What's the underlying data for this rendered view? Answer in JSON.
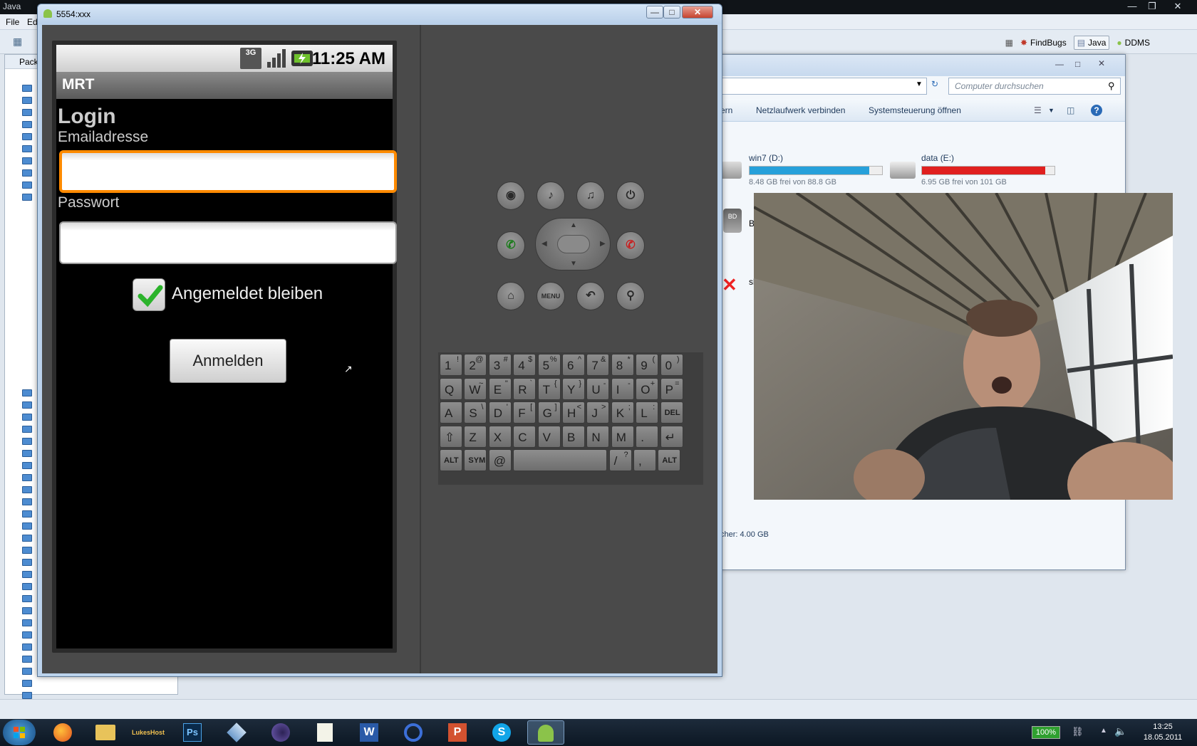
{
  "eclipse": {
    "title": "Java",
    "menu": [
      "File",
      "Ed"
    ],
    "perspectives": [
      "FindBugs",
      "Java",
      "DDMS"
    ],
    "package_explorer_title": "Pack"
  },
  "explorer": {
    "search_placeholder": "Computer durchsuchen",
    "commands": [
      "ern",
      "Netzlaufwerk verbinden",
      "Systemsteuerung öffnen"
    ],
    "drives": [
      {
        "name": "win7 (D:)",
        "free": "8.48 GB frei von 88.8 GB",
        "used_fraction": 0.905,
        "color": "#26a0da"
      },
      {
        "name": "data (E:)",
        "free": "6.95 GB frei von 101 GB",
        "used_fraction": 0.93,
        "color": "#e0201f"
      }
    ],
    "memory": "cher: 4.00 GB",
    "drive_labels": [
      "B",
      "sl"
    ]
  },
  "emulator": {
    "window_title": "5554:xxx",
    "status_time": "11:25 AM",
    "network": "3G",
    "app_title": "MRT",
    "screen_title": "Login",
    "email_label": "Emailadresse",
    "email_value": "",
    "password_label": "Passwort",
    "password_value": "",
    "remember_label": "Angemeldet bleiben",
    "remember_checked": true,
    "login_button": "Anmelden",
    "menu_button": "MENU"
  },
  "keyboard": {
    "rows": [
      [
        [
          "1",
          "!"
        ],
        [
          "2",
          "@"
        ],
        [
          "3",
          "#"
        ],
        [
          "4",
          "$"
        ],
        [
          "5",
          "%"
        ],
        [
          "6",
          "^"
        ],
        [
          "7",
          "&"
        ],
        [
          "8",
          "*"
        ],
        [
          "9",
          "("
        ],
        [
          "0",
          ")"
        ]
      ],
      [
        [
          "Q",
          ""
        ],
        [
          "W",
          "~"
        ],
        [
          "E",
          "\""
        ],
        [
          "R",
          "`"
        ],
        [
          "T",
          "{"
        ],
        [
          "Y",
          "}"
        ],
        [
          "U",
          "-"
        ],
        [
          "I",
          "-"
        ],
        [
          "O",
          "+"
        ],
        [
          "P",
          "="
        ]
      ],
      [
        [
          "A",
          ""
        ],
        [
          "S",
          "\\"
        ],
        [
          "D",
          "'"
        ],
        [
          "F",
          "["
        ],
        [
          "G",
          "]"
        ],
        [
          "H",
          "<"
        ],
        [
          "J",
          ">"
        ],
        [
          "K",
          ";"
        ],
        [
          "L",
          ":"
        ],
        [
          "DEL",
          ""
        ]
      ],
      [
        [
          "⇧",
          ""
        ],
        [
          "Z",
          ""
        ],
        [
          "X",
          ""
        ],
        [
          "C",
          ""
        ],
        [
          "V",
          ""
        ],
        [
          "B",
          ""
        ],
        [
          "N",
          ""
        ],
        [
          "M",
          ""
        ],
        [
          ".",
          ""
        ],
        [
          "↵",
          ""
        ]
      ],
      [
        [
          "ALT",
          ""
        ],
        [
          "SYM",
          ""
        ],
        [
          "@",
          ""
        ],
        [
          "",
          ""
        ],
        [
          "/",
          "?"
        ],
        [
          ",",
          ""
        ],
        [
          "ALT",
          ""
        ]
      ]
    ]
  },
  "taskbar": {
    "apps": [
      "Firefox",
      "Explorer",
      "LukesHost",
      "Ps",
      "VirtualBox",
      "Eclipse",
      "Notepad",
      "W",
      "Network",
      "P",
      "Skype",
      "Android"
    ],
    "battery": "100%",
    "time": "13:25",
    "date": "18.05.2011"
  }
}
